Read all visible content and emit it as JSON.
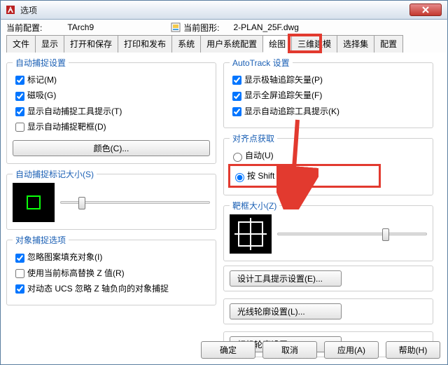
{
  "window": {
    "title": "选项"
  },
  "profile": {
    "left_label": "当前配置:",
    "left_value": "TArch9",
    "right_label": "当前图形:",
    "right_value": "2-PLAN_25F.dwg"
  },
  "tabs": [
    "文件",
    "显示",
    "打开和保存",
    "打印和发布",
    "系统",
    "用户系统配置",
    "绘图",
    "三维建模",
    "选择集",
    "配置"
  ],
  "active_tab_index": 6,
  "left_col": {
    "autosnap": {
      "legend": "自动捕捉设置",
      "items": [
        {
          "label": "标记(M)",
          "checked": true
        },
        {
          "label": "磁吸(G)",
          "checked": true
        },
        {
          "label": "显示自动捕捉工具提示(T)",
          "checked": true
        },
        {
          "label": "显示自动捕捉靶框(D)",
          "checked": false
        }
      ],
      "color_btn": "颜色(C)..."
    },
    "marker_size": {
      "legend": "自动捕捉标记大小(S)",
      "thumb_pct": 12
    },
    "osnap_opts": {
      "legend": "对象捕捉选项",
      "items": [
        {
          "label": "忽略图案填充对象(I)",
          "checked": true
        },
        {
          "label": "使用当前标高替换 Z 值(R)",
          "checked": false
        },
        {
          "label": "对动态 UCS 忽略 Z 轴负向的对象捕捉",
          "checked": true
        }
      ]
    }
  },
  "right_col": {
    "autotrack": {
      "legend": "AutoTrack 设置",
      "items": [
        {
          "label": "显示极轴追踪矢量(P)",
          "checked": true
        },
        {
          "label": "显示全屏追踪矢量(F)",
          "checked": true
        },
        {
          "label": "显示自动追踪工具提示(K)",
          "checked": true
        }
      ]
    },
    "align_acq": {
      "legend": "对齐点获取",
      "auto_label": "自动(U)",
      "shift_label": "按 Shift 键获取(Q)",
      "selected": "shift"
    },
    "aperture": {
      "legend": "靶框大小(Z)",
      "thumb_pct": 70
    },
    "buttons": {
      "design_tooltip": "设计工具提示设置(E)...",
      "light_glyph": "光线轮廓设置(L)...",
      "camera_glyph": "相机轮廓设置(A)..."
    }
  },
  "footer": {
    "ok": "确定",
    "cancel": "取消",
    "apply": "应用(A)",
    "help": "帮助(H)"
  }
}
